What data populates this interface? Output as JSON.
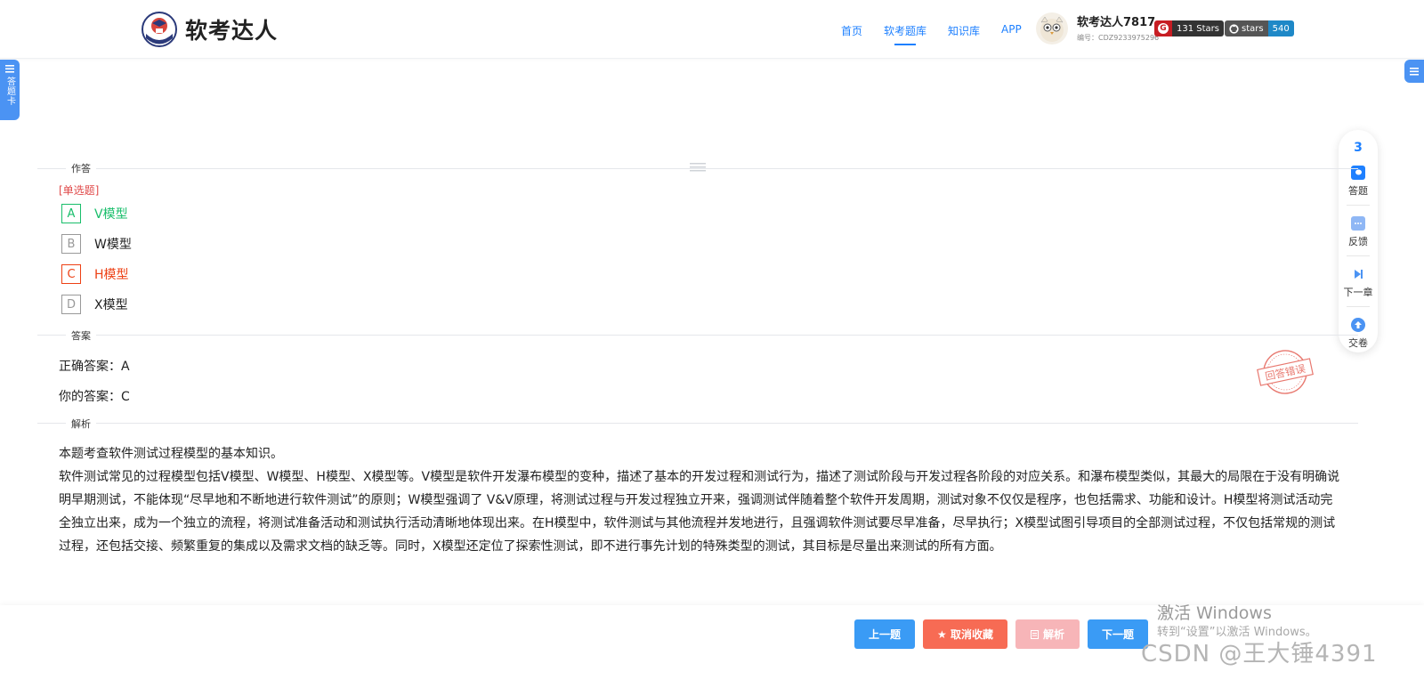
{
  "brand": {
    "name": "软考达人"
  },
  "nav": {
    "items": [
      "首页",
      "软考题库",
      "知识库",
      "APP"
    ],
    "active_index": 1
  },
  "user": {
    "name": "软考达人7817",
    "id_label": "编号：CDZ9233975296"
  },
  "badges": [
    {
      "left": "G",
      "right": "131 Stars",
      "left_color": "#c71d23",
      "right_color": "#333333"
    },
    {
      "left": "stars",
      "right": "540",
      "left_color": "#555555",
      "right_color": "#1e88c7"
    }
  ],
  "left_tab": {
    "label": "答题卡"
  },
  "float_panel": {
    "number": "3",
    "items": [
      {
        "label": "答题",
        "icon": "chat-bubble-icon"
      },
      {
        "label": "反馈",
        "icon": "feedback-icon"
      },
      {
        "label": "下一章",
        "icon": "next-chapter-icon"
      },
      {
        "label": "交卷",
        "icon": "submit-upload-icon"
      }
    ]
  },
  "sections": {
    "answer_area": "作答",
    "answer": "答案",
    "analysis": "解析"
  },
  "question": {
    "type": "[单选题]",
    "options": [
      {
        "letter": "A",
        "text": "V模型",
        "state": "correct"
      },
      {
        "letter": "B",
        "text": "W模型",
        "state": "normal"
      },
      {
        "letter": "C",
        "text": "H模型",
        "state": "wrong"
      },
      {
        "letter": "D",
        "text": "X模型",
        "state": "normal"
      }
    ]
  },
  "answer": {
    "correct": "正确答案：A",
    "yours": "你的答案：C",
    "stamp": "回答错误"
  },
  "analysis": {
    "paragraphs": [
      "本题考查软件测试过程模型的基本知识。",
      "软件测试常见的过程模型包括V模型、W模型、H模型、X模型等。V模型是软件开发瀑布模型的变种，描述了基本的开发过程和测试行为，描述了测试阶段与开发过程各阶段的对应关系。和瀑布模型类似，其最大的局限在于没有明确说明早期测试，不能体现“尽早地和不断地进行软件测试”的原则；W模型强调了 V&V原理，将测试过程与开发过程独立开来，强调测试伴随着整个软件开发周期，测试对象不仅仅是程序，也包括需求、功能和设计。H模型将测试活动完全独立出来，成为一个独立的流程，将测试准备活动和测试执行活动清晰地体现出来。在H模型中，软件测试与其他流程并发地进行，且强调软件测试要尽早准备，尽早执行；X模型试图引导项目的全部测试过程，不仅包括常规的测试过程，还包括交接、频繁重复的集成以及需求文档的缺乏等。同时，X模型还定位了探索性测试，即不进行事先计划的特殊类型的测试，其目标是尽量出来测试的所有方面。"
    ]
  },
  "footer": {
    "prev": "上一题",
    "favorite": "★ 取消收藏",
    "analysis": "解析",
    "next": "下一题"
  },
  "overlay": {
    "activate_title": "激活 Windows",
    "activate_sub": "转到“设置”以激活 Windows。",
    "csdn": "CSDN @王大锤4391"
  },
  "colors": {
    "accent": "#1e80ff",
    "correct": "#19be6b",
    "wrong": "#ed4014",
    "button_blue": "#3a9bf5",
    "button_orange": "#f76b54",
    "button_pink": "#f7b5b8"
  }
}
